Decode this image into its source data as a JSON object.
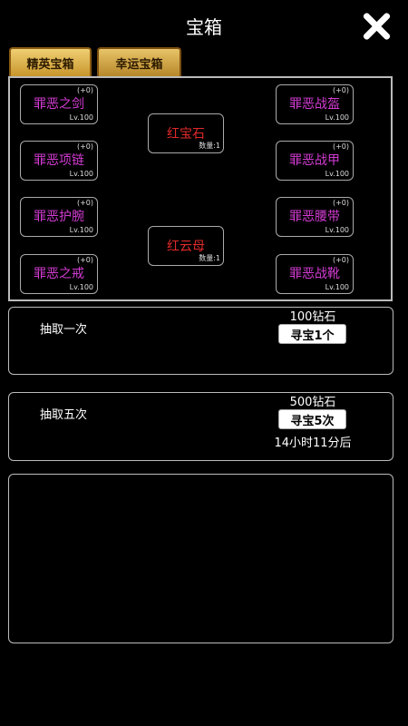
{
  "header": {
    "title": "宝箱"
  },
  "tabs": [
    {
      "label": "精英宝箱",
      "active": true
    },
    {
      "label": "幸运宝箱",
      "active": false
    }
  ],
  "left_items": [
    {
      "name": "罪恶之剑",
      "plus": "(+0)",
      "level": "Lv.100"
    },
    {
      "name": "罪恶项链",
      "plus": "(+0)",
      "level": "Lv.100"
    },
    {
      "name": "罪恶护腕",
      "plus": "(+0)",
      "level": "Lv.100"
    },
    {
      "name": "罪恶之戒",
      "plus": "(+0)",
      "level": "Lv.100"
    }
  ],
  "right_items": [
    {
      "name": "罪恶战盔",
      "plus": "(+0)",
      "level": "Lv.100"
    },
    {
      "name": "罪恶战甲",
      "plus": "(+0)",
      "level": "Lv.100"
    },
    {
      "name": "罪恶腰带",
      "plus": "(+0)",
      "level": "Lv.100"
    },
    {
      "name": "罪恶战靴",
      "plus": "(+0)",
      "level": "Lv.100"
    }
  ],
  "center_items": [
    {
      "name": "红宝石",
      "qty": "数量:1"
    },
    {
      "name": "红云母",
      "qty": "数量:1"
    }
  ],
  "draw_once": {
    "label": "抽取一次",
    "cost": "100钻石",
    "button": "寻宝1个"
  },
  "draw_five": {
    "label": "抽取五次",
    "cost": "500钻石",
    "button": "寻宝5次",
    "timer": "14小时11分后"
  },
  "colors": {
    "item_name": "#d23bd2",
    "gem_name": "#e12a2a",
    "tab_gold": "#e0b450"
  }
}
